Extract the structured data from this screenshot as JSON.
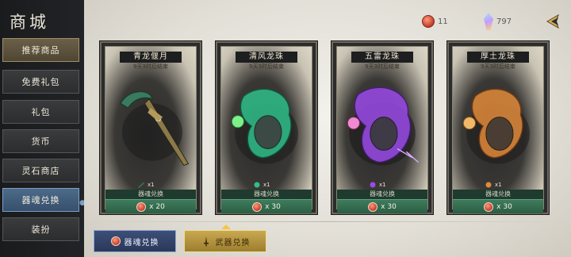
{
  "sidebar": {
    "title": "商城",
    "items": [
      {
        "label": "推荐商品",
        "state": "highlight"
      },
      {
        "label": "免费礼包",
        "state": "normal"
      },
      {
        "label": "礼包",
        "state": "normal"
      },
      {
        "label": "货币",
        "state": "normal"
      },
      {
        "label": "灵石商店",
        "state": "normal"
      },
      {
        "label": "器魂兑换",
        "state": "active"
      },
      {
        "label": "装扮",
        "state": "normal"
      }
    ]
  },
  "topbar": {
    "currency_soul": "11",
    "currency_crystal": "797",
    "back_icon": "back-arrow-icon"
  },
  "cards": [
    {
      "name": "青龙偃月",
      "timer": "9天3时后结束",
      "qty": "x1",
      "exchange_label": "器魂兑换",
      "price": "x 20",
      "color": "#3a7a5e",
      "item": "blade"
    },
    {
      "name": "清风龙珠",
      "timer": "9天3时后结束",
      "qty": "x1",
      "exchange_label": "器魂兑换",
      "price": "x 30",
      "color": "#2fbf8a",
      "item": "dragon-orb"
    },
    {
      "name": "五雷龙珠",
      "timer": "9天3时后结束",
      "qty": "x1",
      "exchange_label": "器魂兑换",
      "price": "x 30",
      "color": "#9a4ae8",
      "item": "dragon-orb"
    },
    {
      "name": "厚土龙珠",
      "timer": "9天3时后结束",
      "qty": "x1",
      "exchange_label": "器魂兑换",
      "price": "x 30",
      "color": "#e08a3a",
      "item": "dragon-orb"
    }
  ],
  "bottom_tabs": [
    {
      "label": "器魂兑换",
      "state": "normal"
    },
    {
      "label": "武器兑换",
      "state": "active"
    }
  ]
}
